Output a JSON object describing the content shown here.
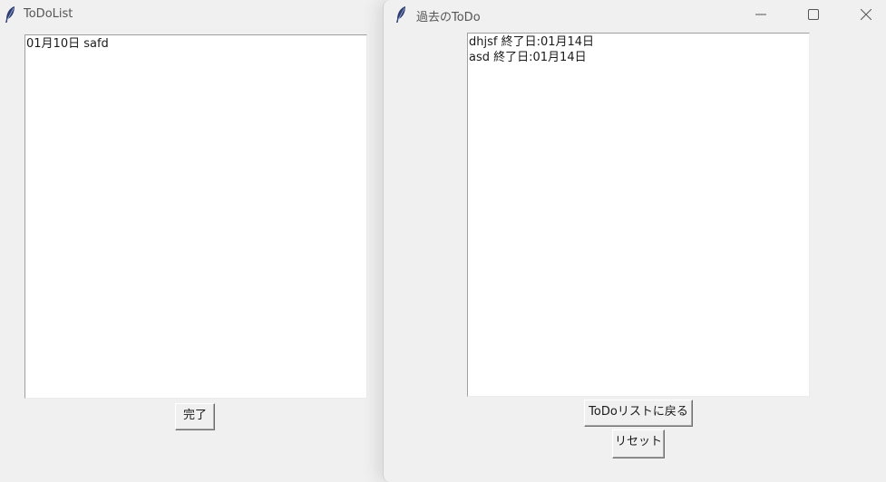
{
  "todo_window": {
    "title": "ToDoList",
    "items": [
      "01月10日 safd"
    ],
    "complete_button": "完了"
  },
  "history_window": {
    "title": "過去のToDo",
    "items": [
      "dhjsf 終了日:01月14日",
      "asd 終了日:01月14日"
    ],
    "back_button": "ToDoリストに戻る",
    "reset_button": "リセット"
  },
  "icons": {
    "app": "feather-icon",
    "minimize": "minimize-icon",
    "maximize": "maximize-icon",
    "close": "close-icon"
  }
}
